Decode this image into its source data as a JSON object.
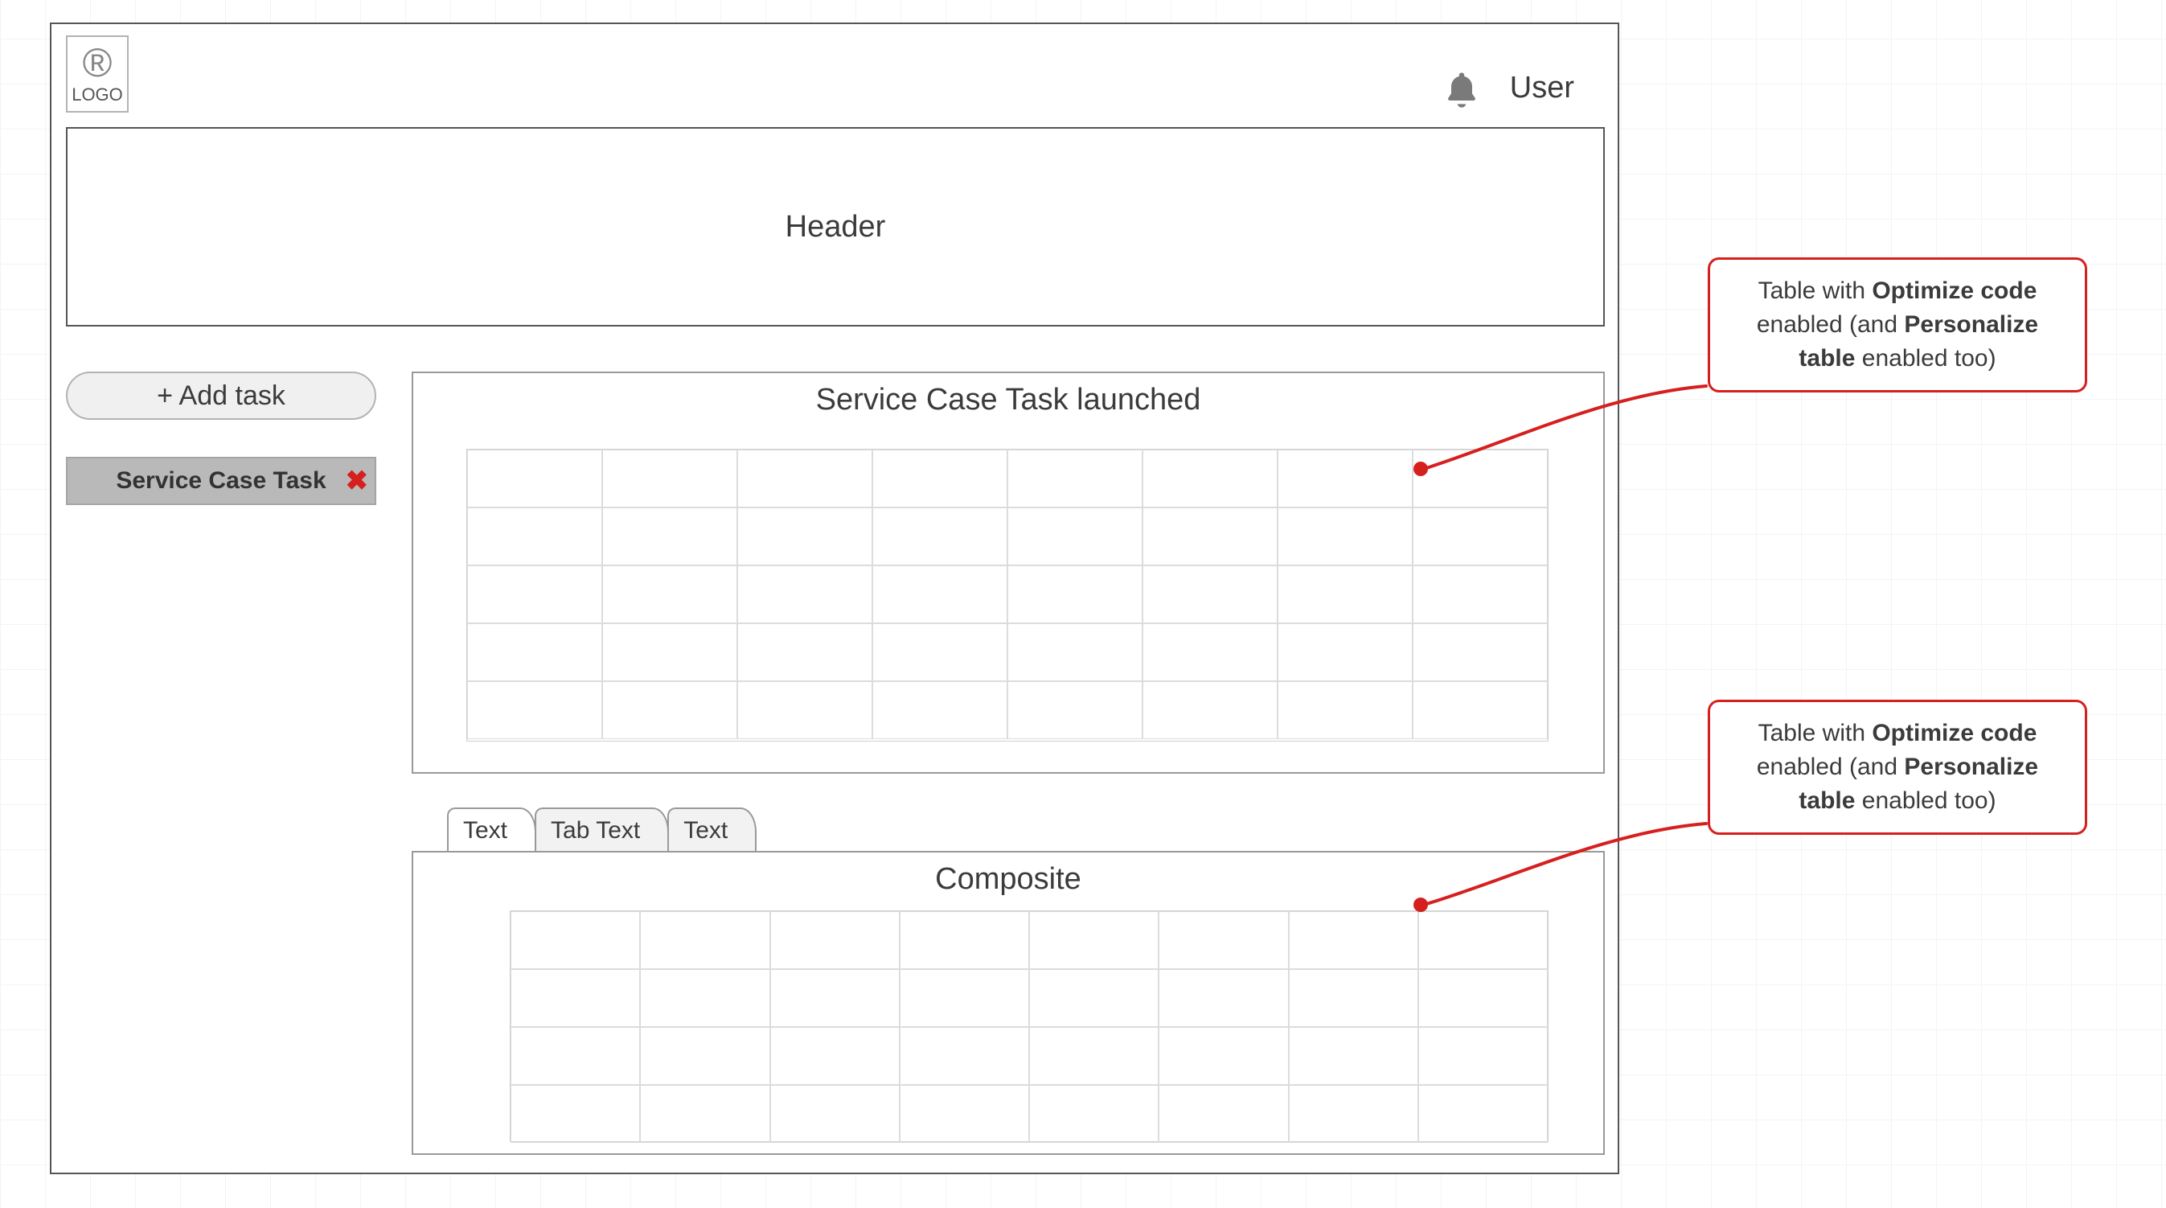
{
  "topbar": {
    "logo_label": "LOGO",
    "user_label": "User"
  },
  "header": {
    "title": "Header"
  },
  "sidebar": {
    "add_task_label": "+ Add task",
    "task_chip_label": "Service Case Task"
  },
  "launched_panel": {
    "title": "Service Case Task launched",
    "table": {
      "rows": 5,
      "cols": 8
    }
  },
  "composite": {
    "tabs": [
      {
        "label": "Text",
        "active": true
      },
      {
        "label": "Tab Text",
        "active": false
      },
      {
        "label": "Text",
        "active": false
      }
    ],
    "title": "Composite",
    "table": {
      "rows": 4,
      "cols": 8
    }
  },
  "callouts": {
    "c1_prefix": "Table with ",
    "c1_bold1": "Optimize code",
    "c1_mid": " enabled (and ",
    "c1_bold2": "Personalize table",
    "c1_suffix": " enabled too)",
    "c2_prefix": "Table with ",
    "c2_bold1": "Optimize code",
    "c2_mid": " enabled (and ",
    "c2_bold2": "Personalize table",
    "c2_suffix": " enabled too)"
  }
}
